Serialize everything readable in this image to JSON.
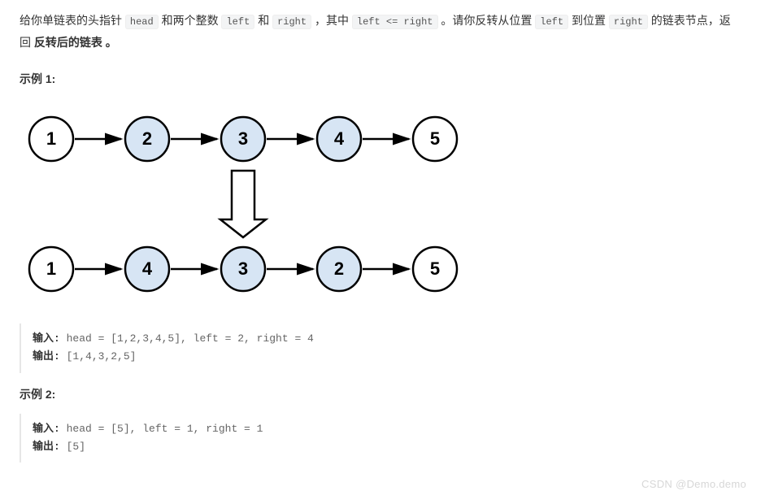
{
  "desc": {
    "t1": "给你单链表的头指针 ",
    "c1": "head",
    "t2": " 和两个整数 ",
    "c2": "left",
    "t3": " 和 ",
    "c3": "right",
    "t4": " ，其中 ",
    "c4": "left <= right",
    "t5": " 。请你反转从位置 ",
    "c5": "left",
    "t6": " 到位置 ",
    "c6": "right",
    "t7": " 的链表节点，返回 ",
    "b1": "反转后的链表 。"
  },
  "ex1_title": "示例 1:",
  "diagram": {
    "top": [
      "1",
      "2",
      "3",
      "4",
      "5"
    ],
    "bottom": [
      "1",
      "4",
      "3",
      "2",
      "5"
    ],
    "highlight_top": [
      false,
      true,
      true,
      true,
      false
    ],
    "highlight_bottom": [
      false,
      true,
      true,
      true,
      false
    ]
  },
  "ex1": {
    "in_lbl": "输入:",
    "in_val": " head = [1,2,3,4,5], left = 2, right = 4",
    "out_lbl": "输出:",
    "out_val": " [1,4,3,2,5]"
  },
  "ex2_title": "示例 2:",
  "ex2": {
    "in_lbl": "输入:",
    "in_val": " head = [5], left = 1, right = 1",
    "out_lbl": "输出:",
    "out_val": " [5]"
  },
  "watermark": "CSDN @Demo.demo"
}
